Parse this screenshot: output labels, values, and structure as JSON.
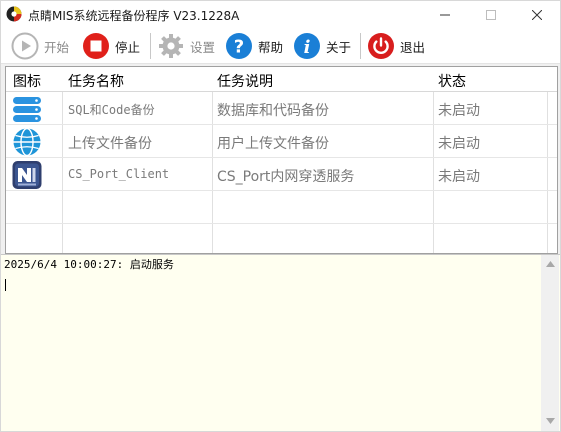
{
  "window": {
    "title": "点睛MIS系统远程备份程序 V23.1228A",
    "controls": {
      "minimize": "minimize-icon",
      "maximize": "maximize-icon",
      "close": "close-icon"
    }
  },
  "toolbar": {
    "start": {
      "label": "开始",
      "icon": "play-icon",
      "enabled": false
    },
    "stop": {
      "label": "停止",
      "icon": "stop-icon",
      "color": "#e0201a"
    },
    "settings": {
      "label": "设置",
      "icon": "gear-icon",
      "enabled": false
    },
    "help": {
      "label": "帮助",
      "icon": "question-icon",
      "color": "#1a7fd6"
    },
    "about": {
      "label": "关于",
      "icon": "info-icon",
      "color": "#1a7fd6"
    },
    "exit": {
      "label": "退出",
      "icon": "power-icon",
      "color": "#d81e1e"
    }
  },
  "table": {
    "headers": {
      "icon": "图标",
      "name": "任务名称",
      "desc": "任务说明",
      "status": "状态"
    },
    "rows": [
      {
        "icon": "database-icon",
        "name": "SQL和Code备份",
        "desc": "数据库和代码备份",
        "status": "未启动"
      },
      {
        "icon": "globe-upload-icon",
        "name": "上传文件备份",
        "desc": "用户上传文件备份",
        "status": "未启动"
      },
      {
        "icon": "network-client-icon",
        "name": "CS_Port_Client",
        "desc": "CS_Port内网穿透服务",
        "status": "未启动"
      }
    ]
  },
  "log": {
    "lines": [
      "2025/6/4 10:00:27: 启动服务"
    ]
  },
  "colors": {
    "log_background": "#fffff0",
    "accent_blue": "#1a7fd6",
    "stop_red": "#e0201a"
  }
}
